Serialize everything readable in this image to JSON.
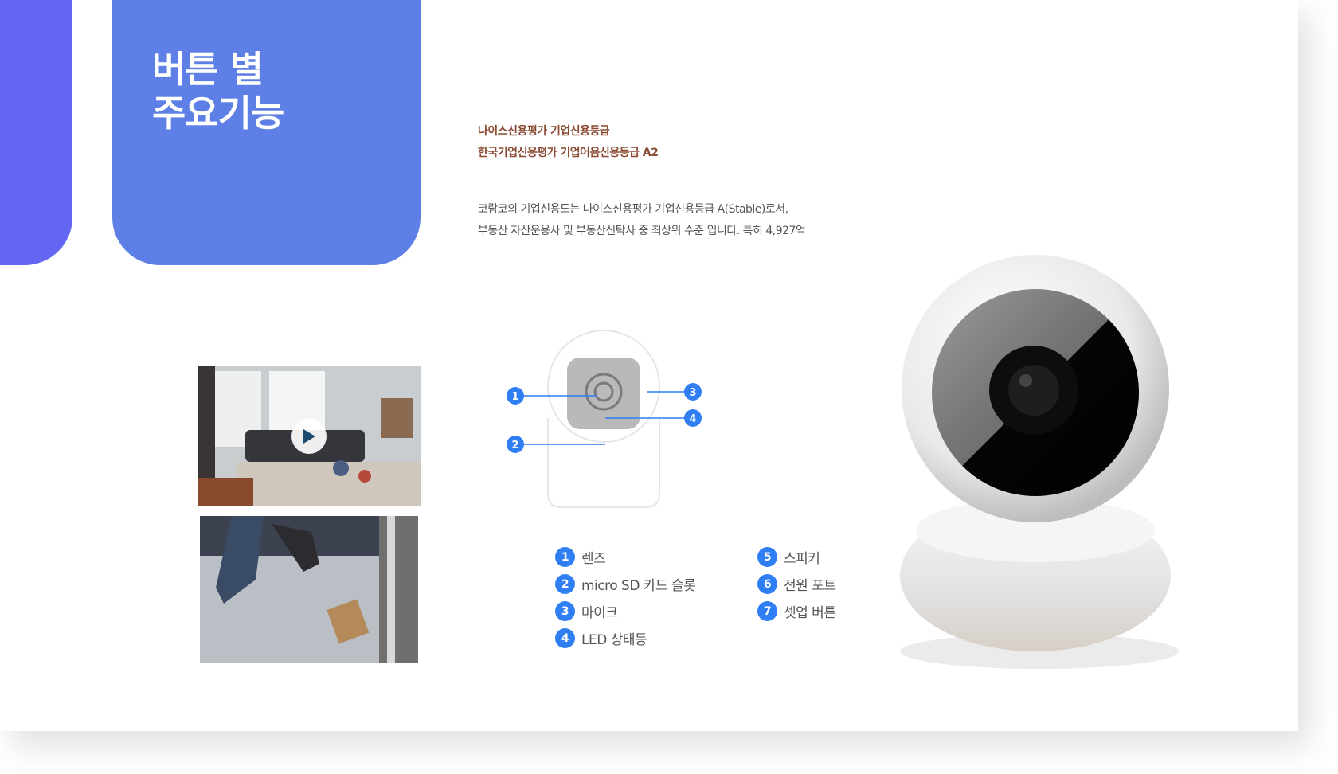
{
  "colors": {
    "accent_bar": "#6266f1",
    "title_block": "#5d7fe6",
    "rating_text": "#8a4a32",
    "badge_blue": "#2f7ef3"
  },
  "slide": {
    "title_line1": "버튼 별",
    "title_line2": "주요기능",
    "rating": {
      "line1": "나이스신용평가 기업신용등급",
      "line2": "한국기업신용평가 기업어음신용등급 A2"
    },
    "description": {
      "line1": "코람코의 기업신용도는 나이스신용평가 기업신용등급 A(Stable)로서,",
      "line2": "부동산 자산운용사 및 부동산신탁사 중 최상위 수준 입니다. 특히 4,927억"
    }
  },
  "media": {
    "video_thumb_icon": "play-icon"
  },
  "legend": [
    {
      "num": "1",
      "label": "렌즈"
    },
    {
      "num": "2",
      "label": "micro SD 카드 슬롯"
    },
    {
      "num": "3",
      "label": "마이크"
    },
    {
      "num": "4",
      "label": "LED 상태등"
    },
    {
      "num": "5",
      "label": "스피커"
    },
    {
      "num": "6",
      "label": "전원 포트"
    },
    {
      "num": "7",
      "label": "셋업 버튼"
    }
  ],
  "diagram_markers": [
    "1",
    "2",
    "3",
    "4"
  ]
}
